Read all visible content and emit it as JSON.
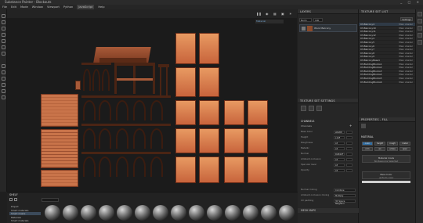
{
  "app": {
    "title": "Substance Painter - Blockouts",
    "window_controls": [
      "_",
      "□",
      "×"
    ]
  },
  "menu": [
    "File",
    "Edit",
    "Mode",
    "Window",
    "Viewport",
    "Python",
    "JavaScript",
    "Help"
  ],
  "menu_active_index": 6,
  "viewport": {
    "mode_dropdown": "Material",
    "tools": [
      "pause",
      "camera",
      "grid",
      "display",
      "lights"
    ]
  },
  "layers": {
    "title": "LAYERS",
    "blend_mode": "Norm",
    "opacity": "100",
    "fill_label": "Base Color",
    "layer_name": "Wood Balcony"
  },
  "texture_set_list": {
    "title": "TEXTURE SET LIST",
    "setting_btn": "Settings",
    "items": [
      {
        "name": "03-Balcony4",
        "shader": "Main shader"
      },
      {
        "name": "03-Balcony10",
        "shader": "Main shader"
      },
      {
        "name": "03-Balcony11",
        "shader": "Main shader"
      },
      {
        "name": "03-Balcony12",
        "shader": "Main shader"
      },
      {
        "name": "03-Balcony4",
        "shader": "Main shader"
      },
      {
        "name": "03-Balcony5",
        "shader": "Main shader"
      },
      {
        "name": "03-Balcony6",
        "shader": "Main shader"
      },
      {
        "name": "03-Balcony7",
        "shader": "Main shader"
      },
      {
        "name": "03-Balcony8",
        "shader": "Main shader"
      },
      {
        "name": "03-Balcony9",
        "shader": "Main shader"
      },
      {
        "name": "03-BalconyBase1",
        "shader": "Main shader"
      },
      {
        "name": "03-BuildingBlocks1",
        "shader": "Main shader"
      },
      {
        "name": "03-BuildingBlocks2",
        "shader": "Main shader"
      },
      {
        "name": "03-BuildingBlocks3",
        "shader": "Main shader"
      },
      {
        "name": "03-BuildingBlocks4",
        "shader": "Main shader"
      },
      {
        "name": "03-BuildingBlocks5",
        "shader": "Main shader"
      },
      {
        "name": "03-BuildingBlocks6",
        "shader": "Main shader"
      }
    ]
  },
  "texture_set_settings": {
    "title": "TEXTURE SET SETTINGS",
    "channels_title": "CHANNELS",
    "channels": [
      {
        "label": "Base Color",
        "format": "sRGB8"
      },
      {
        "label": "Height",
        "format": "L16F"
      },
      {
        "label": "Roughness",
        "format": "L8"
      },
      {
        "label": "Metallic",
        "format": "L8"
      },
      {
        "label": "Normal",
        "format": "RGB16F"
      },
      {
        "label": "Ambient occlusion",
        "format": "L8"
      },
      {
        "label": "Specular level",
        "format": "L8"
      },
      {
        "label": "Opacity",
        "format": "L8"
      }
    ],
    "normal_mixing_label": "Normal mixing",
    "normal_mixing_value": "Combine",
    "ao_mixing_label": "Ambient occlusion mixing",
    "ao_mixing_value": "Multiply",
    "uv_padding_label": "UV padding",
    "uv_padding_value": "3D Space Neighbor",
    "mesh_maps_title": "MESH MAPS"
  },
  "properties": {
    "title": "PROPERTIES - FILL",
    "section": "MATERIAL",
    "channel_buttons": [
      "color",
      "height",
      "rough",
      "metal",
      "nrm",
      "ao",
      "emiss",
      "spec"
    ],
    "preset_label": "Material mode",
    "preset_sub": "No Resource Selected",
    "base_color_label": "Base Color",
    "base_color_sub": "uniform color"
  },
  "shelf": {
    "title": "SHELF",
    "categories": [
      "Project",
      "Smart materials",
      "Smart masks",
      "Materials",
      "Smart materials"
    ],
    "selected_category": 2,
    "search_placeholder": "Search..."
  },
  "colors": {
    "accent": "#2f6fa6",
    "wood": "#c9744a",
    "panel": "#262626"
  }
}
